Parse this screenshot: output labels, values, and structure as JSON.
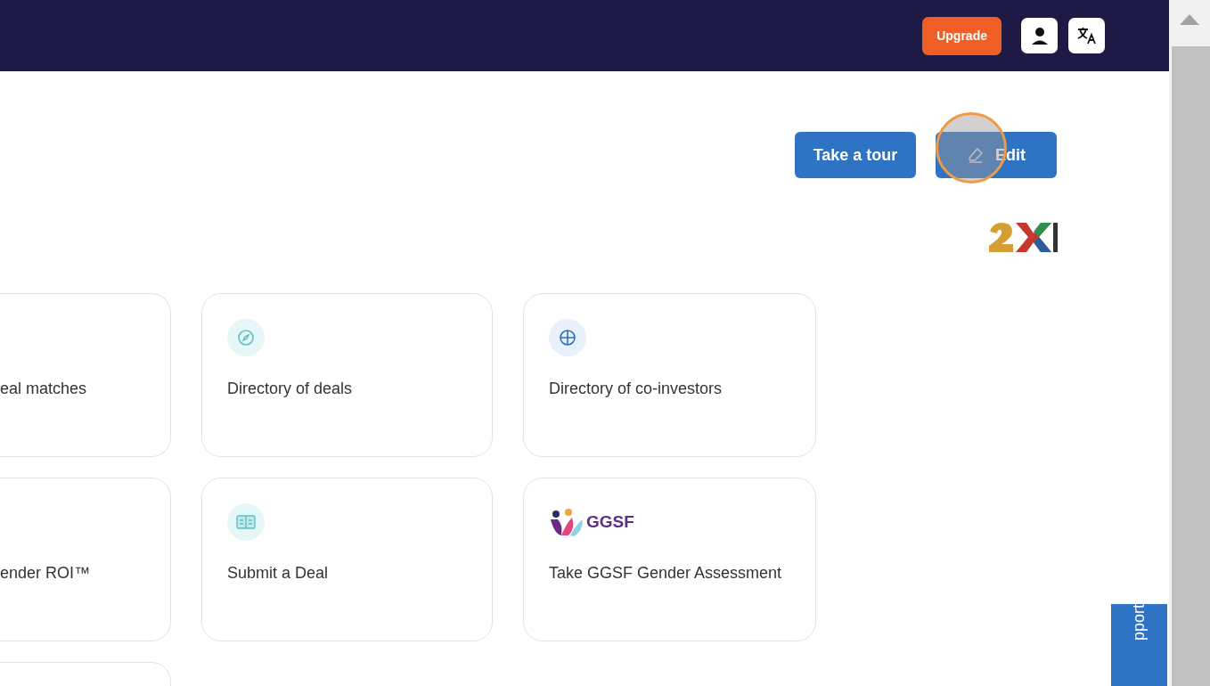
{
  "header": {
    "upgrade_button": "Upgrade"
  },
  "toolbar": {
    "tour_button": "Take a tour",
    "edit_button": "Edit"
  },
  "card_rows": [
    [
      {
        "kind": "cut",
        "label": "eal matches"
      },
      {
        "kind": "compass",
        "label": "Directory of deals"
      },
      {
        "kind": "globe",
        "label": "Directory of co-investors"
      }
    ],
    [
      {
        "kind": "cut",
        "label": "ender ROI™"
      },
      {
        "kind": "id",
        "label": "Submit a Deal"
      },
      {
        "kind": "ggsf",
        "logo_text": "GGSF",
        "label": "Take GGSF Gender Assessment"
      }
    ],
    [
      {
        "kind": "cut"
      }
    ]
  ],
  "support_tab": "pport"
}
